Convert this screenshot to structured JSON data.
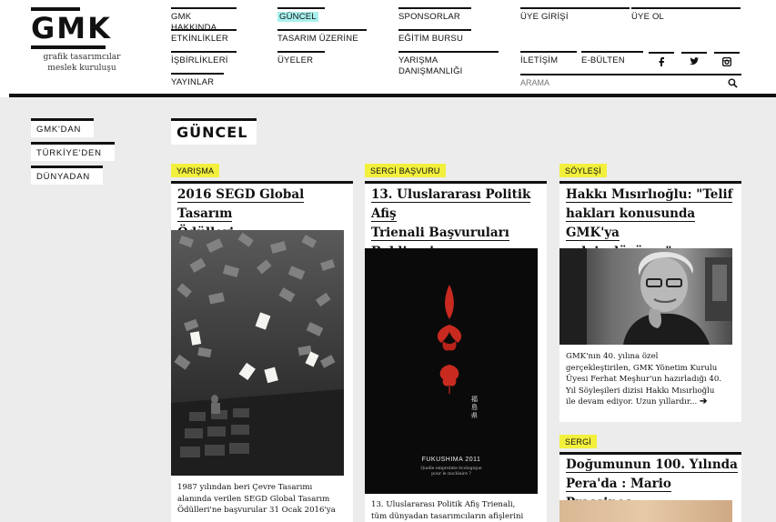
{
  "logo": {
    "word": "GMK",
    "line1": "grafik tasarımcılar",
    "line2": "meslek kuruluşu"
  },
  "nav": {
    "col1": [
      "GMK HAKKINDA",
      "ETKİNLİKLER",
      "İŞBİRLİKLERİ",
      "YAYINLAR"
    ],
    "col2": [
      "GÜNCEL",
      "TASARIM ÜZERİNE",
      "ÜYELER"
    ],
    "col3": [
      "SPONSORLAR",
      "EĞİTİM BURSU",
      "YARIŞMA",
      "DANIŞMANLIĞI"
    ],
    "member_login": "ÜYE GİRİŞİ",
    "become_member": "ÜYE OL",
    "contact": "İLETİŞİM",
    "newsletter": "E-BÜLTEN",
    "social": [
      "f",
      "♥",
      "◘"
    ]
  },
  "search": {
    "placeholder": "ARAMA"
  },
  "sidebar": [
    "GMK'DAN",
    "TÜRKİYE'DEN",
    "DÜNYADAN"
  ],
  "page_title": "GÜNCEL",
  "cards": [
    {
      "category": "YARIŞMA",
      "title_lines": [
        "2016 SEGD Global Tasarım",
        "Ödülleri"
      ],
      "text_lines": [
        "1987 yılından beri Çevre Tasarımı",
        "alanında verilen SEGD Global Tasarım",
        "Ödülleri'ne başvurular 31 Ocak 2016'ya"
      ]
    },
    {
      "category": "SERGİ BAŞVURU",
      "title_lines": [
        "13. Uluslararası Politik Afiş",
        "Trienali Başvuruları",
        "Bekliyor!"
      ],
      "poster_caption": "FUKUSHIMA 2011",
      "poster_sub1": "Quelle empreinte écologique",
      "poster_sub2": "pour le nucléaire ?",
      "poster_kanji": "福島県",
      "text_lines": [
        "13. Uluslararası Politik Afiş Trienali,",
        "tüm dünyadan tasarımcıların afişlerini"
      ]
    },
    {
      "category": "SÖYLEŞİ",
      "title_lines": [
        "Hakkı Mısırlıoğlu: \"Telif",
        "hakları konusunda GMK'ya",
        "çok iş düşüyor\""
      ],
      "text_lines": [
        "GMK'nın 40. yılına özel",
        "gerçekleştirilen, GMK Yönetim Kurulu",
        "Üyesi Ferhat Meşhur'un hazırladığı 40.",
        "Yıl Söyleşileri dizisi Hakkı Mısırlıoğlu",
        "ile devam ediyor. Uzun yıllardır..."
      ],
      "more_arrow": "➔"
    },
    {
      "category": "SERGİ",
      "title_lines": [
        "Doğumunun 100. Yılında",
        "Pera'da : Mario Prassinos"
      ]
    }
  ],
  "colors": {
    "accent_cyan": "#a8f0ee",
    "category_yellow": "#f2f03c",
    "ink": "#111111",
    "page_bg": "#ececec"
  }
}
